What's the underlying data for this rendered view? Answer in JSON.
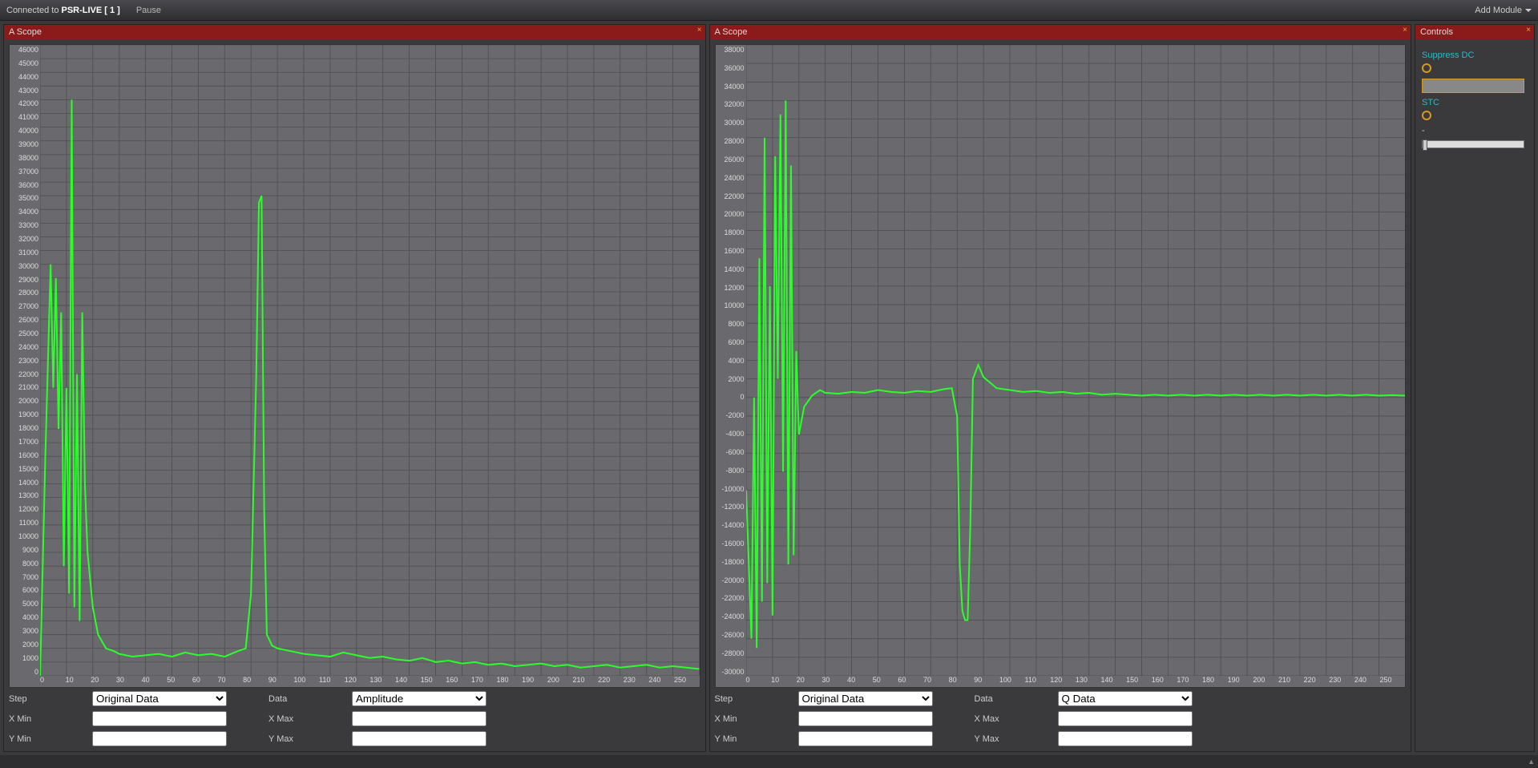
{
  "topbar": {
    "connected_prefix": "Connected to ",
    "connected_target": "PSR-LIVE [ 1 ]",
    "pause": "Pause",
    "add_module": "Add Module"
  },
  "scope1": {
    "title": "A Scope",
    "step_label": "Step",
    "data_label": "Data",
    "xmin_label": "X Min",
    "xmax_label": "X Max",
    "ymin_label": "Y Min",
    "ymax_label": "Y Max",
    "step_value": "Original Data",
    "data_value": "Amplitude",
    "xmin_value": "",
    "xmax_value": "",
    "ymin_value": "",
    "ymax_value": ""
  },
  "scope2": {
    "title": "A Scope",
    "step_label": "Step",
    "data_label": "Data",
    "xmin_label": "X Min",
    "xmax_label": "X Max",
    "ymin_label": "Y Min",
    "ymax_label": "Y Max",
    "step_value": "Original Data",
    "data_value": "Q Data",
    "xmin_value": "",
    "xmax_value": "",
    "ymin_value": "",
    "ymax_value": ""
  },
  "controls": {
    "title": "Controls",
    "suppress_dc": "Suppress DC",
    "stc": "STC",
    "dash": "-"
  },
  "chart_data": [
    {
      "type": "line",
      "title": "A Scope",
      "xlabel": "",
      "ylabel": "",
      "xlim": [
        0,
        250
      ],
      "ylim": [
        0,
        46000
      ],
      "x_ticks": [
        0,
        10,
        20,
        30,
        40,
        50,
        60,
        70,
        80,
        90,
        100,
        110,
        120,
        130,
        140,
        150,
        160,
        170,
        180,
        190,
        200,
        210,
        220,
        230,
        240,
        250
      ],
      "y_ticks": [
        0,
        1000,
        2000,
        3000,
        4000,
        5000,
        6000,
        7000,
        8000,
        9000,
        10000,
        11000,
        12000,
        13000,
        14000,
        15000,
        16000,
        17000,
        18000,
        19000,
        20000,
        21000,
        22000,
        23000,
        24000,
        25000,
        26000,
        27000,
        28000,
        29000,
        30000,
        31000,
        32000,
        33000,
        34000,
        35000,
        36000,
        37000,
        38000,
        39000,
        40000,
        41000,
        42000,
        43000,
        44000,
        45000,
        46000
      ],
      "series": [
        {
          "name": "Amplitude",
          "color": "#2aff2a",
          "x": [
            0,
            2,
            4,
            5,
            6,
            7,
            8,
            9,
            10,
            11,
            12,
            13,
            14,
            15,
            16,
            17,
            18,
            20,
            22,
            25,
            28,
            30,
            35,
            40,
            45,
            50,
            55,
            60,
            65,
            70,
            75,
            78,
            80,
            82,
            83,
            84,
            85,
            86,
            88,
            90,
            95,
            100,
            105,
            110,
            115,
            120,
            125,
            130,
            135,
            140,
            145,
            150,
            155,
            160,
            165,
            170,
            175,
            180,
            185,
            190,
            195,
            200,
            205,
            210,
            215,
            220,
            225,
            230,
            235,
            240,
            245,
            250
          ],
          "y": [
            0,
            16000,
            30000,
            21000,
            29000,
            18000,
            26500,
            8000,
            21000,
            6000,
            42000,
            5000,
            22000,
            4000,
            26500,
            14000,
            9000,
            5000,
            3000,
            2000,
            1800,
            1600,
            1400,
            1500,
            1600,
            1400,
            1700,
            1500,
            1600,
            1400,
            1800,
            2000,
            6000,
            22000,
            34500,
            35000,
            12000,
            3000,
            2200,
            2000,
            1800,
            1600,
            1500,
            1400,
            1700,
            1500,
            1300,
            1400,
            1200,
            1100,
            1300,
            1000,
            1100,
            900,
            1000,
            800,
            900,
            700,
            800,
            900,
            700,
            800,
            600,
            700,
            800,
            600,
            700,
            800,
            600,
            700,
            600,
            500
          ]
        }
      ]
    },
    {
      "type": "line",
      "title": "A Scope",
      "xlabel": "",
      "ylabel": "",
      "xlim": [
        0,
        250
      ],
      "ylim": [
        -30000,
        38000
      ],
      "x_ticks": [
        0,
        10,
        20,
        30,
        40,
        50,
        60,
        70,
        80,
        90,
        100,
        110,
        120,
        130,
        140,
        150,
        160,
        170,
        180,
        190,
        200,
        210,
        220,
        230,
        240,
        250
      ],
      "y_ticks": [
        -30000,
        -28000,
        -26000,
        -24000,
        -22000,
        -20000,
        -18000,
        -16000,
        -14000,
        -12000,
        -10000,
        -8000,
        -6000,
        -4000,
        -2000,
        0,
        2000,
        4000,
        6000,
        8000,
        10000,
        12000,
        14000,
        16000,
        18000,
        20000,
        22000,
        24000,
        26000,
        28000,
        30000,
        32000,
        34000,
        36000,
        38000
      ],
      "series": [
        {
          "name": "Q Data",
          "color": "#2aff2a",
          "x": [
            0,
            2,
            3,
            4,
            5,
            6,
            7,
            8,
            9,
            10,
            11,
            12,
            13,
            14,
            15,
            16,
            17,
            18,
            19,
            20,
            22,
            25,
            28,
            30,
            35,
            40,
            45,
            50,
            55,
            60,
            65,
            70,
            75,
            78,
            80,
            81,
            82,
            83,
            84,
            85,
            86,
            88,
            90,
            95,
            100,
            105,
            110,
            115,
            120,
            125,
            130,
            135,
            140,
            145,
            150,
            155,
            160,
            165,
            170,
            175,
            180,
            185,
            190,
            195,
            200,
            205,
            210,
            215,
            220,
            225,
            230,
            235,
            240,
            245,
            250
          ],
          "y": [
            -10000,
            -26000,
            0,
            -27000,
            15000,
            -22000,
            28000,
            -20000,
            12000,
            -23500,
            26000,
            2000,
            30500,
            -8000,
            32000,
            -18000,
            25000,
            -17000,
            5000,
            -4000,
            -1000,
            200,
            800,
            500,
            400,
            600,
            500,
            800,
            600,
            500,
            700,
            600,
            900,
            1000,
            -2000,
            -18000,
            -23000,
            -24000,
            -24000,
            -14000,
            2000,
            3500,
            2200,
            1000,
            800,
            600,
            700,
            500,
            600,
            400,
            500,
            300,
            400,
            300,
            200,
            300,
            200,
            300,
            200,
            300,
            200,
            300,
            200,
            300,
            200,
            300,
            200,
            300,
            200,
            300,
            200,
            300,
            200,
            250,
            200
          ]
        }
      ]
    }
  ]
}
